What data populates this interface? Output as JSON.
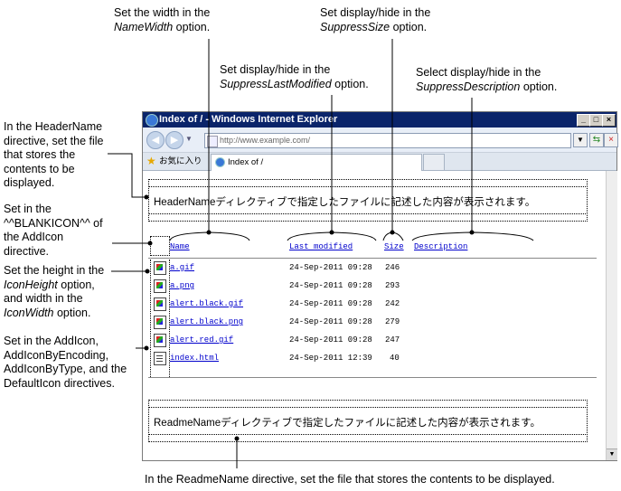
{
  "annotations": {
    "name_width": [
      "Set the width in the",
      "NameWidth",
      " option."
    ],
    "suppress_size": [
      "Set display/hide in the",
      "SuppressSize",
      " option."
    ],
    "suppress_last_modified": [
      "Set display/hide in the",
      "SuppressLastModified",
      " option."
    ],
    "suppress_description": [
      "Select display/hide in the",
      "SuppressDescription",
      " option."
    ],
    "header_name": [
      "In the HeaderName",
      "directive, set the file",
      "that stores the",
      "contents to be",
      "displayed."
    ],
    "blank_icon": [
      "Set in the",
      "^^BLANKICON^^ of",
      "the AddIcon",
      "directive."
    ],
    "icon_size": [
      "Set the height in the",
      "IconHeight",
      " option,",
      "and width in the",
      "IconWidth",
      " option."
    ],
    "add_icon": [
      "Set in the AddIcon,",
      "AddIconByEncoding,",
      "AddIconByType, and the",
      "DefaultIcon directives."
    ],
    "readme_name": "In the ReadmeName directive, set the file that stores the contents to be displayed."
  },
  "window": {
    "title": "Index of / - Windows Internet Explorer",
    "address": "http://www.example.com/",
    "favorites": "お気に入り",
    "tab": "Index of /"
  },
  "page": {
    "header_text": "HeaderNameディレクティブで指定したファイルに記述した内容が表示されます。",
    "readme_text": "ReadmeNameディレクティブで指定したファイルに記述した内容が表示されます。",
    "columns": {
      "name": "Name",
      "last_modified": "Last modified",
      "size": "Size",
      "description": "Description"
    },
    "files": [
      {
        "name": "a.gif",
        "date": "24-Sep-2011 09:28",
        "size": "246",
        "icon": "image-file-icon"
      },
      {
        "name": "a.png",
        "date": "24-Sep-2011 09:28",
        "size": "293",
        "icon": "image-file-icon"
      },
      {
        "name": "alert.black.gif",
        "date": "24-Sep-2011 09:28",
        "size": "242",
        "icon": "image-file-icon"
      },
      {
        "name": "alert.black.png",
        "date": "24-Sep-2011 09:28",
        "size": "279",
        "icon": "image-file-icon"
      },
      {
        "name": "alert.red.gif",
        "date": "24-Sep-2011 09:28",
        "size": "247",
        "icon": "image-file-icon"
      },
      {
        "name": "index.html",
        "date": "24-Sep-2011 12:39",
        "size": "40",
        "icon": "text-file-icon"
      }
    ]
  }
}
